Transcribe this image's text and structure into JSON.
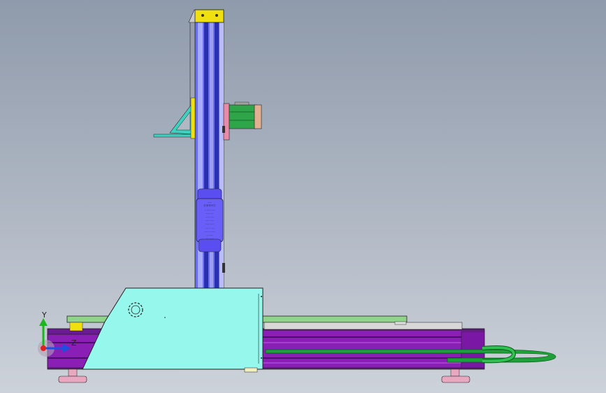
{
  "colors": {
    "column": "#8a8ff0",
    "column_dark": "#3a3fd0",
    "rail_purple": "#8a1fb5",
    "rail_purple_dark": "#4a0d6a",
    "base_cyan": "#96f7ec",
    "bed_green": "#8fd48a",
    "motor_green": "#2fa54a",
    "cable_green": "#1fa03a",
    "top_cap": "#f0e010",
    "bracket_teal": "#40d0c0",
    "feet_pink": "#e8a8c0",
    "axis_y": "#1fb51f",
    "axis_z": "#1f4fe0",
    "axis_x": "#e01f1f"
  },
  "label_plate_lines": [
    "......",
    "Ⓛⓐⓑⓔⓛ",
    ".. ...... ....",
    "..... ....",
    "...... .....",
    "..... ......",
    "...... .....",
    ". ...... ....",
    "...... .. ....",
    "... ......",
    "..... ......"
  ],
  "triad": {
    "y_label": "Y",
    "z_label": "Z"
  }
}
